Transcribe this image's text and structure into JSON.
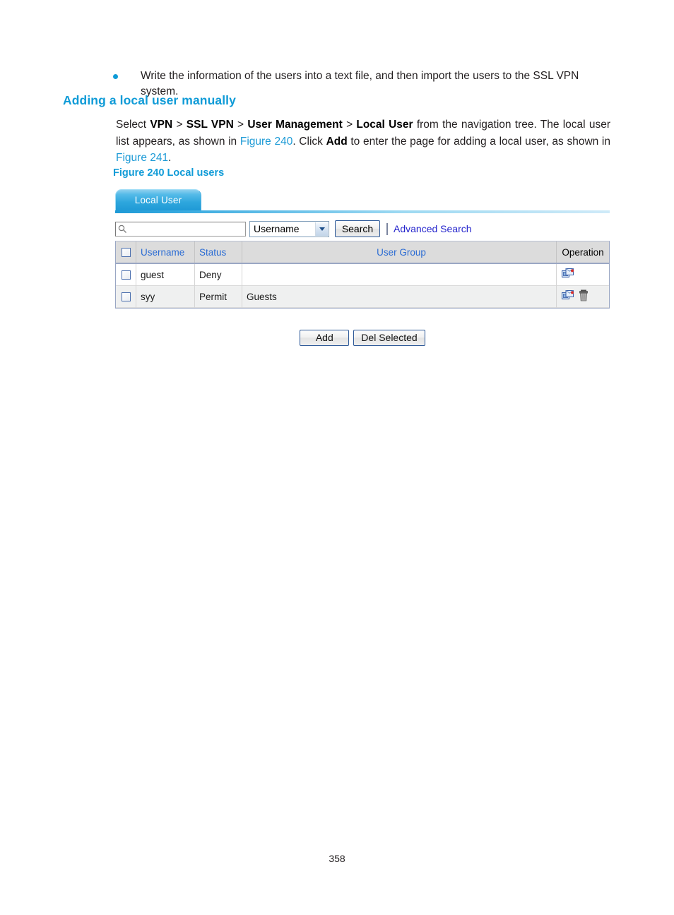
{
  "document": {
    "bullet_item": "Write the information of the users into a text file, and then import the users to the SSL VPN system.",
    "heading": "Adding a local user manually",
    "paragraph": {
      "p1": "Select ",
      "nav1": "VPN",
      "sep1": " > ",
      "nav2": "SSL VPN",
      "sep2": " > ",
      "nav3": "User Management",
      "sep3": " > ",
      "nav4": "Local User",
      "p2": " from the navigation tree. The local user list appears, as shown in ",
      "xref1": "Figure 240",
      "p3": ". Click ",
      "bold_add": "Add",
      "p4": " to enter the page for adding a local user, as shown in ",
      "xref2": "Figure 241",
      "p5": "."
    },
    "figure_caption": "Figure 240 Local users",
    "page_number": "358"
  },
  "screenshot": {
    "tab": {
      "label": "Local User"
    },
    "search": {
      "input_value": "",
      "input_placeholder": "",
      "magnifier_icon": "search-icon",
      "field_selected": "Username",
      "field_options": [
        "Username"
      ],
      "search_button": "Search",
      "advanced_search_link": "Advanced Search"
    },
    "table": {
      "columns": [
        "",
        "Username",
        "Status",
        "User Group",
        "Operation"
      ],
      "rows": [
        {
          "checked": false,
          "username": "guest",
          "status": "Deny",
          "user_group": "",
          "operations": [
            "edit-icon"
          ]
        },
        {
          "checked": false,
          "username": "syy",
          "status": "Permit",
          "user_group": "Guests",
          "operations": [
            "edit-icon",
            "delete-icon"
          ]
        }
      ]
    },
    "buttons": {
      "add": "Add",
      "del_selected": "Del Selected"
    }
  },
  "colors": {
    "accent_blue": "#0f9bd7",
    "link_blue": "#2b6cd4",
    "anchor_blue": "#2525cc",
    "tab_blue": "#2ea6dd",
    "header_grey": "#dcdcdc",
    "row_alt_grey": "#eff0f0"
  }
}
